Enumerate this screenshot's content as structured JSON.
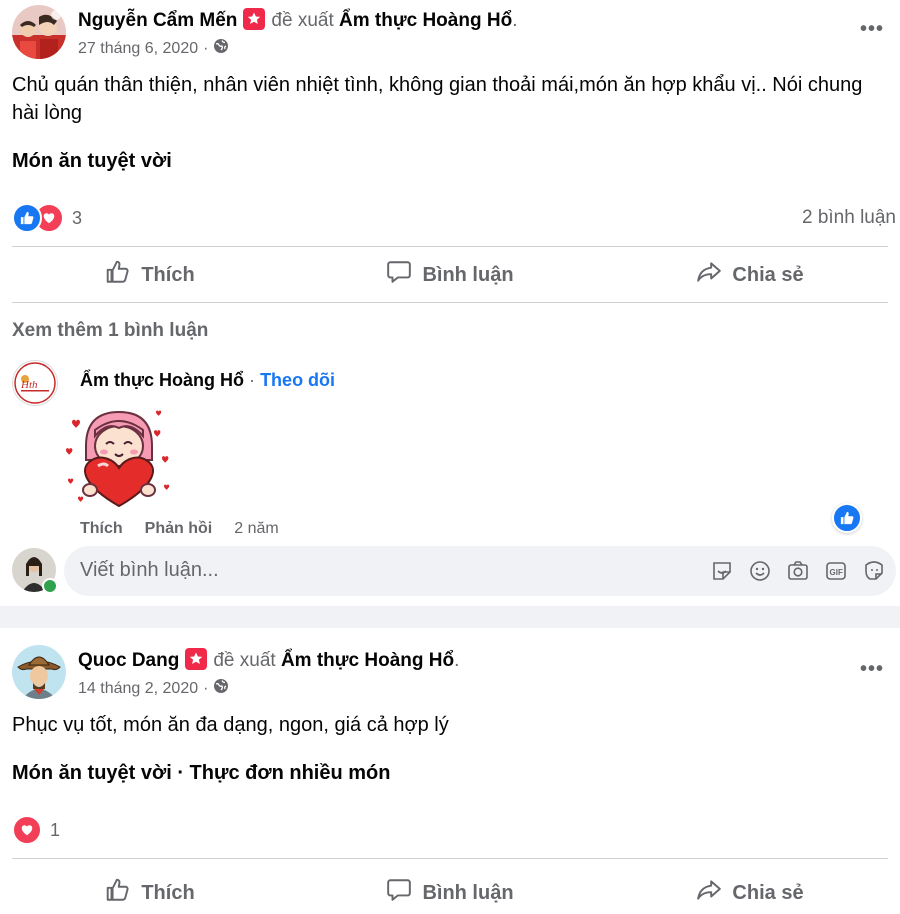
{
  "posts": [
    {
      "author": "Nguyễn Cẩm Mến",
      "recommends": "đề xuất",
      "page": "Ẩm thực Hoàng Hổ",
      "date": "27 tháng 6, 2020",
      "text": "Chủ quán thân thiện, nhân viên nhiệt tình, không gian thoải mái,món ăn hợp khẩu vị.. Nói chung hài lòng",
      "tags": "Món ăn tuyệt vời",
      "reaction_count": "3",
      "comment_count": "2 bình luận",
      "reactions": [
        "like-icon",
        "love-icon"
      ]
    },
    {
      "author": "Quoc Dang",
      "recommends": "đề xuất",
      "page": "Ẩm thực Hoàng Hổ",
      "date": "14 tháng 2, 2020",
      "text": "Phục vụ tốt, món ăn đa dạng, ngon, giá cả hợp lý",
      "tags": "Món ăn tuyệt vời · Thực đơn nhiều món",
      "reaction_count": "1",
      "reactions": [
        "love-icon"
      ]
    }
  ],
  "actions": {
    "like": "Thích",
    "comment": "Bình luận",
    "share": "Chia sẻ"
  },
  "comments": {
    "view_more": "Xem thêm 1 bình luận",
    "item": {
      "author": "Ẩm thực Hoàng Hổ",
      "separator": "·",
      "follow": "Theo dõi",
      "like": "Thích",
      "reply": "Phản hồi",
      "time": "2 năm",
      "sticker": "heart-girl-sticker"
    },
    "input_placeholder": "Viết bình luận...",
    "input_icons": [
      "sticker-icon",
      "emoji-icon",
      "camera-icon",
      "gif-icon",
      "avatar-sticker-icon"
    ]
  },
  "colors": {
    "link": "#1877f2",
    "muted": "#65676b",
    "love": "#f33e58",
    "badge": "#f02849",
    "online": "#31a24c"
  }
}
